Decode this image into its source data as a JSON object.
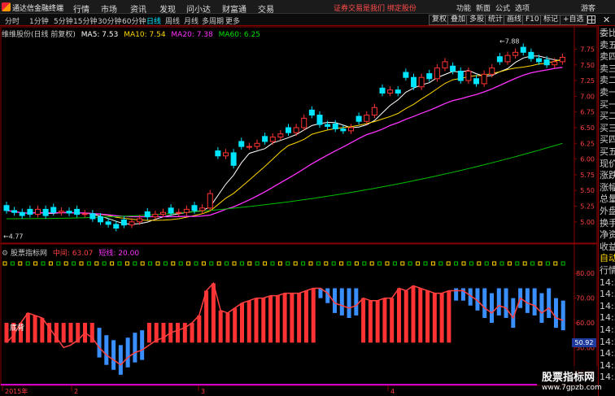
{
  "app": {
    "title": "通达信金融终端"
  },
  "menu": [
    "行情",
    "市场",
    "资讯",
    "发现",
    "问小达",
    "财富通",
    "交易"
  ],
  "promo": "证券交易是我们 绑定股份",
  "right_menu": [
    "功能",
    "新面",
    "公式",
    "选项",
    "游客"
  ],
  "toolbar": {
    "periods": [
      "分时",
      "1分钟",
      "5分钟",
      "15分钟",
      "30分钟",
      "60分钟",
      "日线",
      "周线",
      "月线",
      "多周期",
      "更多"
    ],
    "active_period": "日线",
    "buttons": [
      "复权",
      "叠加",
      "多股",
      "统计",
      "画线",
      "F10",
      "标记",
      "+自选"
    ]
  },
  "main_chart": {
    "stock_label": "维维股份(日线 前复权)",
    "ma": [
      {
        "label": "MA5: 7.53",
        "color": "#ffffff"
      },
      {
        "label": "MA10: 7.54",
        "color": "#ffd700"
      },
      {
        "label": "MA20: 7.38",
        "color": "#ff33ff"
      },
      {
        "label": "MA60: 6.25",
        "color": "#00e000"
      }
    ],
    "price_ticks": [
      "7.75",
      "7.50",
      "7.25",
      "7.00",
      "6.75",
      "6.50",
      "6.25",
      "6.00",
      "5.75",
      "5.50",
      "5.25",
      "5.00"
    ],
    "high_label": "7.88",
    "low_label": "4.77"
  },
  "indicator": {
    "name": "股票指标网",
    "items": [
      {
        "label": "中间: 63.07",
        "color": "#ff4040"
      },
      {
        "label": "短线: 20.00",
        "color": "#ff33ff"
      }
    ],
    "ticks": [
      "80.00",
      "70.00",
      "60.00",
      "50.00",
      "40.00"
    ],
    "bottom_label": "底背",
    "current_value": "50.92"
  },
  "time_axis": [
    "2015年",
    "2",
    "3",
    "4"
  ],
  "side_panel": {
    "items": [
      "委比",
      "卖五",
      "卖四",
      "卖三",
      "卖二",
      "卖一",
      "买一",
      "买二",
      "买三",
      "买四",
      "买五",
      "现价",
      "涨跌",
      "涨幅",
      "总量",
      "外盘",
      "换手",
      "净资",
      "收益",
      "自动",
      "行情",
      "14:55",
      "14:55",
      "14:55",
      "14:55",
      "14:55",
      "14:55",
      "14:55",
      "14:55",
      "14:55"
    ]
  },
  "watermark": {
    "line1": "股票指标网",
    "line2": "www.7gpzb.com"
  },
  "colors": {
    "up": "#ff3333",
    "down": "#00e5ff",
    "panel_border": "#8b0000"
  },
  "chart_data": {
    "type": "candlestick",
    "price_range": [
      4.7,
      7.95
    ],
    "indicator_range": [
      36,
      86
    ],
    "indicator_bars": [
      52,
      55,
      60,
      64,
      63,
      62,
      58,
      54,
      50,
      51,
      53,
      56,
      54,
      50,
      47,
      45,
      43,
      46,
      48,
      49,
      51,
      53,
      54,
      56,
      57,
      58,
      60,
      63,
      73,
      76,
      65,
      64,
      66,
      68,
      69,
      70,
      70,
      71,
      71,
      72,
      72,
      72,
      73,
      74,
      74,
      72,
      68,
      67,
      66,
      67,
      70,
      69,
      69,
      70,
      70,
      74,
      73,
      75,
      74,
      73,
      72,
      72,
      73,
      73,
      73,
      71,
      69,
      66,
      64,
      67,
      66,
      62,
      70,
      68,
      67,
      64,
      66,
      62,
      61
    ],
    "close_prices": [
      5.18,
      5.15,
      5.1,
      5.12,
      5.2,
      5.1,
      5.15,
      5.17,
      5.14,
      5.12,
      5.13,
      5.05,
      5.0,
      4.96,
      4.9,
      4.95,
      5.0,
      5.05,
      5.08,
      5.12,
      5.15,
      5.14,
      5.15,
      5.2,
      5.18,
      5.22,
      5.45,
      6.05,
      6.1,
      5.9,
      6.2,
      6.2,
      6.25,
      6.28,
      6.35,
      6.4,
      6.42,
      6.5,
      6.65,
      6.7,
      6.55,
      6.52,
      6.48,
      6.45,
      6.5,
      6.6,
      6.7,
      6.82,
      7.05,
      7.1,
      7.05,
      7.3,
      7.15,
      7.3,
      7.28,
      7.45,
      7.55,
      7.4,
      7.25,
      7.4,
      7.2,
      7.35,
      7.45,
      7.55,
      7.65,
      7.7,
      7.7,
      7.6,
      7.55,
      7.5,
      7.55,
      7.62
    ]
  }
}
